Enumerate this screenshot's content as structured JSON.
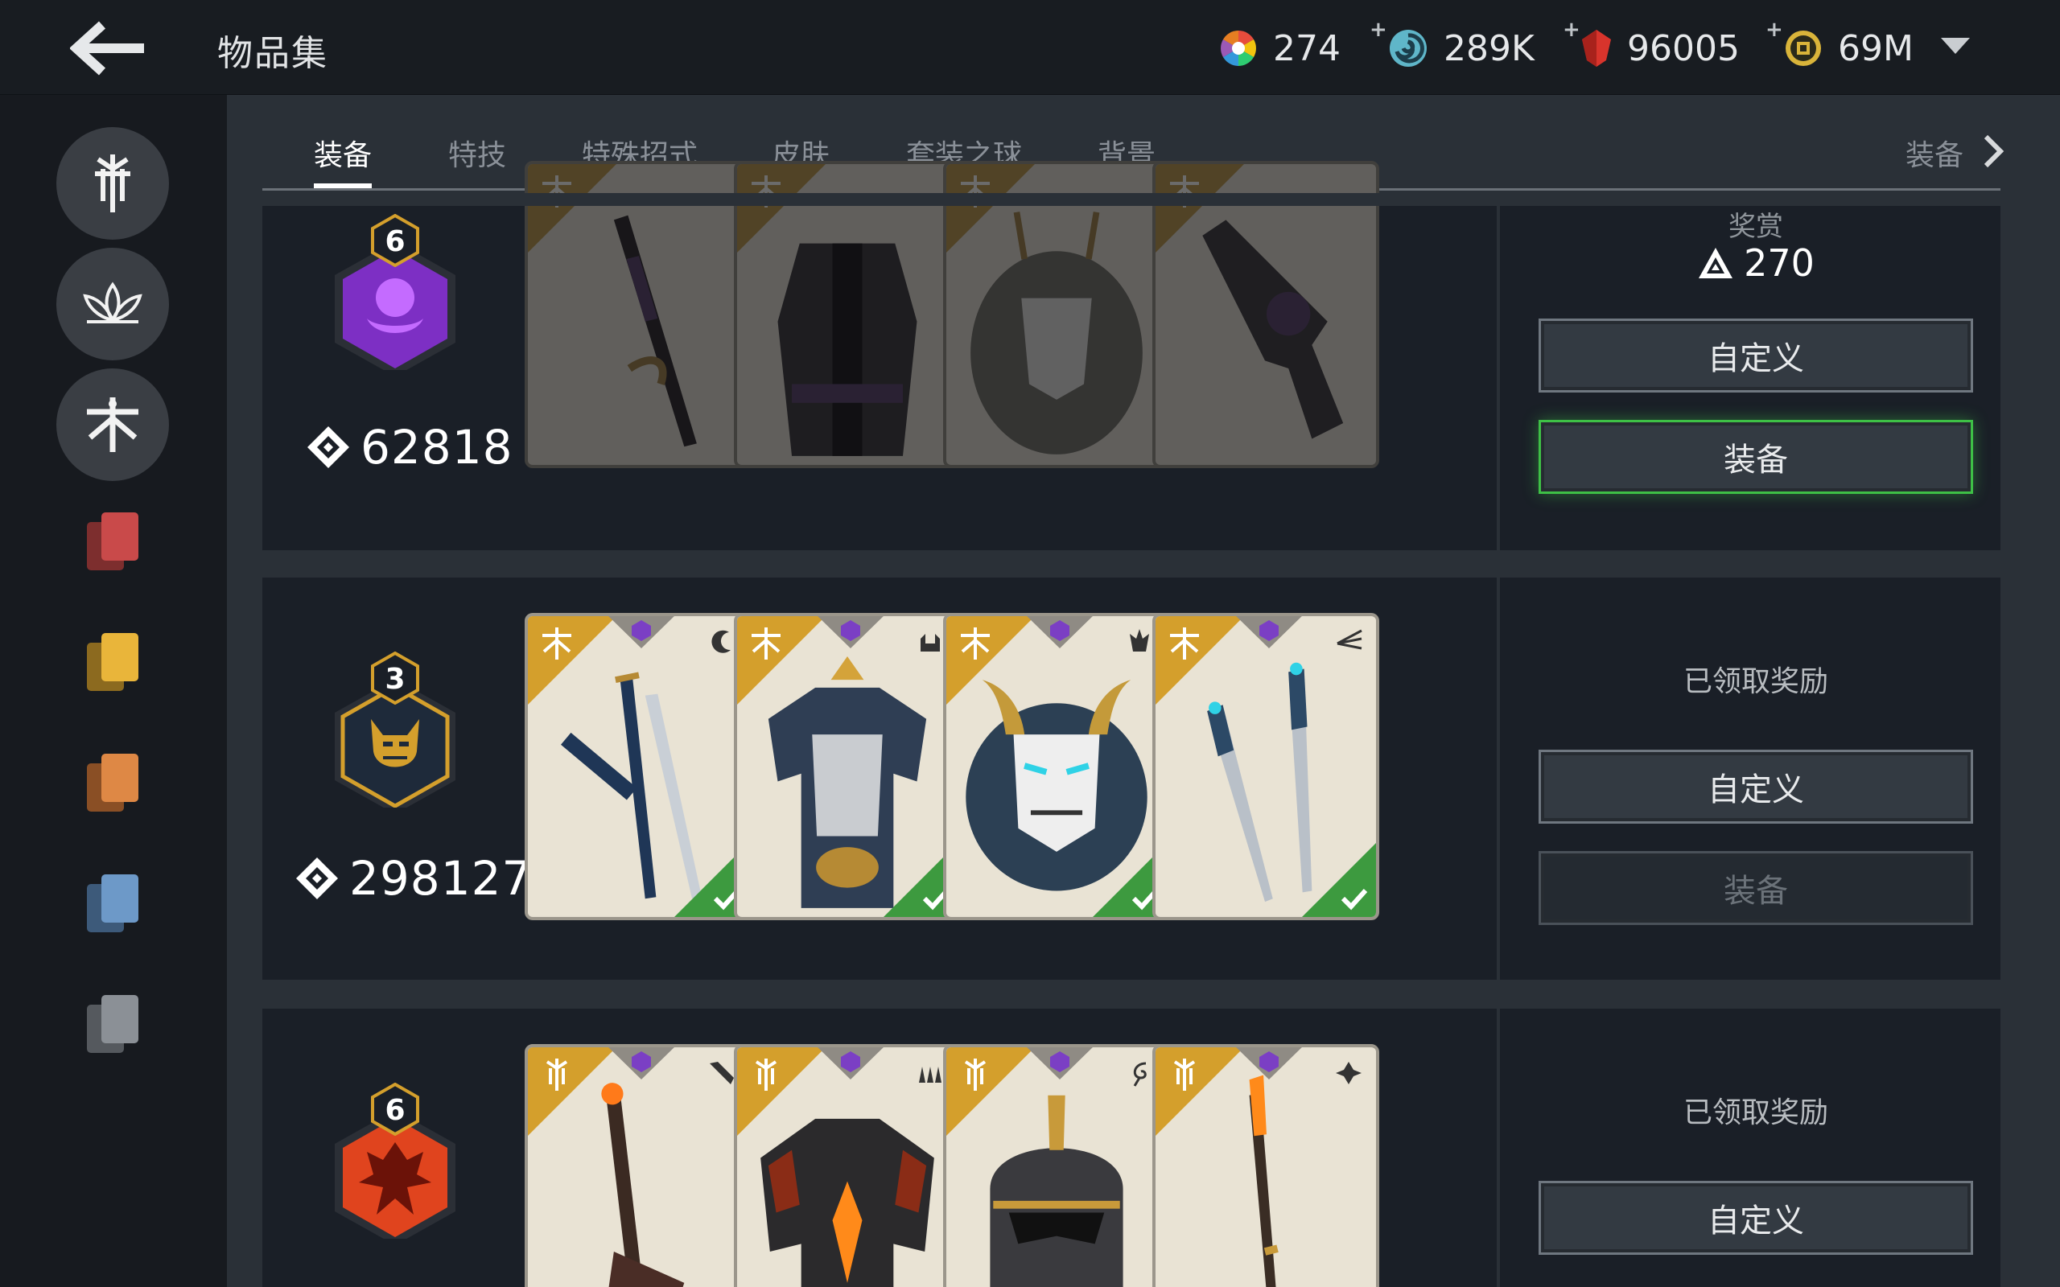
{
  "header": {
    "title": "物品集",
    "currencies": [
      {
        "icon": "color-wheel-icon",
        "value": "274",
        "plus": false
      },
      {
        "icon": "swirl-orb-icon",
        "value": "289K",
        "plus": true
      },
      {
        "icon": "red-crystal-icon",
        "value": "96005",
        "plus": true
      },
      {
        "icon": "gold-coin-icon",
        "value": "69M",
        "plus": true
      }
    ],
    "plus_symbol": "+"
  },
  "tabs": {
    "items": [
      "装备",
      "特技",
      "特殊招式",
      "皮肤",
      "套装之球",
      "背景"
    ],
    "active": 0,
    "overflow_label": "装备"
  },
  "sidebar": {
    "factions": [
      "knight-faction-icon",
      "lotus-faction-icon",
      "samurai-faction-icon"
    ],
    "decks": [
      {
        "name": "red-deck-icon",
        "color": "#c94a4a"
      },
      {
        "name": "yellow-deck-icon",
        "color": "#e9b53a"
      },
      {
        "name": "orange-deck-icon",
        "color": "#de8845"
      },
      {
        "name": "blue-deck-icon",
        "color": "#6d99c8"
      },
      {
        "name": "gray-deck-icon",
        "color": "#8b9096"
      }
    ]
  },
  "sets": [
    {
      "level": "6",
      "badge_color": "#7d2fc4",
      "score": "62818",
      "locked": true,
      "reward_label": "奖赏",
      "reward_amount": "270",
      "customize_label": "自定义",
      "equip_label": "装备",
      "cards": [
        "sword-card",
        "outfit-card",
        "mask-card",
        "revolver-card"
      ]
    },
    {
      "level": "3",
      "badge_color": "#d49f2c",
      "score": "298127",
      "locked": false,
      "status": "已领取奖励",
      "customize_label": "自定义",
      "equip_label": "装备",
      "cards": [
        "katana-card",
        "armor-card",
        "oni-mask-card",
        "daggers-card"
      ]
    },
    {
      "level": "6",
      "badge_color": "#e0441e",
      "status": "已领取奖励",
      "customize_label": "自定义",
      "cards": [
        "flame-blade-card",
        "lava-armor-card",
        "helmet-card",
        "spear-card"
      ]
    }
  ],
  "colors": {
    "accent_green": "#3ec046",
    "rarity_gold": "#d49f2c",
    "gem_purple": "#7b3fc4"
  }
}
